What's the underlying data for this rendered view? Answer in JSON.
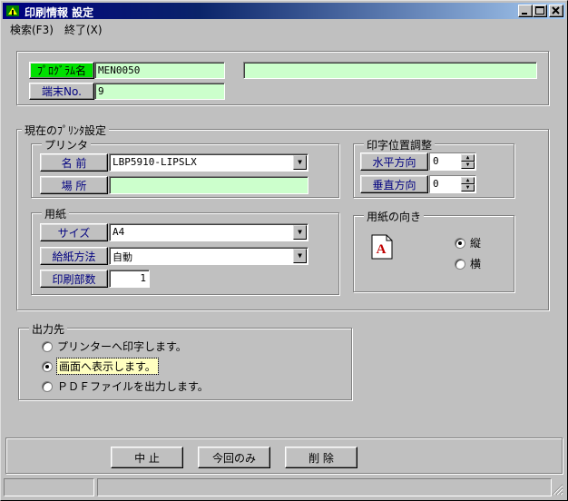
{
  "window": {
    "title": "印刷情報 設定",
    "icon": "app-icon",
    "caption_buttons": {
      "minimize": "_",
      "maximize": "□",
      "close": "×"
    }
  },
  "menu": [
    {
      "label": "検索(F3)"
    },
    {
      "label": "終了(X)"
    }
  ],
  "program": {
    "label": "ﾌﾟﾛｸﾞﾗﾑ名",
    "code": "MEN0050",
    "name": ""
  },
  "terminal": {
    "label": "端末No.",
    "value": "9"
  },
  "printer_settings": {
    "group_label": "現在のﾌﾟﾘﾝﾀ設定",
    "printer": {
      "group_label": "プリンタ",
      "name_label": "名 前",
      "name_value": "LBP5910-LIPSLX",
      "location_label": "場 所",
      "location_value": ""
    },
    "paper": {
      "group_label": "用紙",
      "size_label": "サイズ",
      "size_value": "A4",
      "feed_label": "給紙方法",
      "feed_value": "自動",
      "copies_label": "印刷部数",
      "copies_value": "1"
    },
    "position": {
      "group_label": "印字位置調整",
      "horizontal_label": "水平方向",
      "horizontal_value": "0",
      "vertical_label": "垂直方向",
      "vertical_value": "0"
    },
    "orientation": {
      "group_label": "用紙の向き",
      "icon_glyph": "A",
      "options": [
        {
          "label": "縦",
          "selected": true
        },
        {
          "label": "横",
          "selected": false
        }
      ]
    }
  },
  "output": {
    "group_label": "出力先",
    "options": [
      {
        "label": "プリンターへ印字します。",
        "selected": false
      },
      {
        "label": "画面へ表示します。",
        "selected": true
      },
      {
        "label": "ＰＤＦファイルを出力します。",
        "selected": false
      }
    ]
  },
  "buttons": {
    "cancel": "中 止",
    "this_time_only": "今回のみ",
    "delete": "削 除"
  },
  "colors": {
    "title_gradient_start": "#000080",
    "field_green": "#ccffcc",
    "program_label_green": "#00e000",
    "label_button_text": "#000080"
  }
}
